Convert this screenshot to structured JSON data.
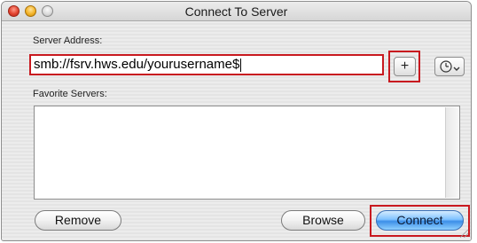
{
  "window": {
    "title": "Connect To Server"
  },
  "server_address": {
    "label": "Server Address:",
    "value": "smb://fsrv.hws.edu/yourusername$"
  },
  "controls": {
    "add_label": "+",
    "history_icon": "clock-chevron-icon"
  },
  "favorites": {
    "label": "Favorite Servers:",
    "items": []
  },
  "buttons": {
    "remove_label": "Remove",
    "browse_label": "Browse",
    "connect_label": "Connect"
  },
  "colors": {
    "highlight": "#c8191f",
    "default_button": "#7fc2ff"
  }
}
